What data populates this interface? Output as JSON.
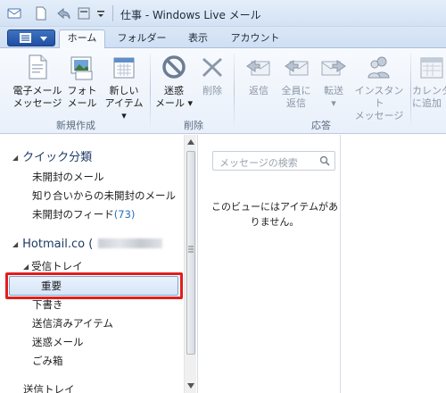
{
  "window": {
    "title": "仕事 - Windows Live メール"
  },
  "tabs": [
    {
      "label": "ホーム",
      "active": true
    },
    {
      "label": "フォルダー",
      "active": false
    },
    {
      "label": "表示",
      "active": false
    },
    {
      "label": "アカウント",
      "active": false
    }
  ],
  "ribbon": {
    "new_group": {
      "label": "新規作成",
      "email_line1": "電子メール",
      "email_line2": "メッセージ",
      "photo_line1": "フォト",
      "photo_line2": "メール",
      "newitem_line1": "新しい",
      "newitem_line2": "アイテム ▾"
    },
    "delete_group": {
      "label": "削除",
      "junk_line1": "迷惑",
      "junk_line2": "メール ▾",
      "delete_label": "削除"
    },
    "respond_group": {
      "label": "応答",
      "reply_label": "返信",
      "replyall_line1": "全員に",
      "replyall_line2": "返信",
      "forward_line1": "転送",
      "forward_line2": "▾",
      "im_line1": "インスタント",
      "im_line2": "メッセージ"
    },
    "calendar": {
      "line1": "カレンダ",
      "line2": "に追加"
    }
  },
  "folders": {
    "quick_views": {
      "header": "クイック分類",
      "unread_mail": "未開封のメール",
      "unread_contacts": "知り合いからの未開封のメール",
      "unread_feeds": "未開封のフィード",
      "unread_feeds_count": "(73)"
    },
    "account": {
      "name": "Hotmail.co (",
      "inbox": "受信トレイ",
      "important": "重要",
      "drafts": "下書き",
      "sent": "送信済みアイテム",
      "junk": "迷惑メール",
      "deleted": "ごみ箱",
      "outbox": "送信トレイ"
    }
  },
  "message_list": {
    "search_placeholder": "メッセージの検索",
    "empty_text": "このビューにはアイテムがありません。"
  },
  "colors": {
    "accent": "#1f4fa3",
    "highlight": "#e01e1e",
    "count": "#2a6ebb"
  },
  "icons": [
    "app-menu-icon",
    "new-email-icon",
    "photo-email-icon",
    "new-item-icon",
    "junk-icon",
    "delete-x-icon",
    "reply-icon",
    "reply-all-icon",
    "forward-icon",
    "instant-message-icon",
    "calendar-icon",
    "search-icon"
  ]
}
